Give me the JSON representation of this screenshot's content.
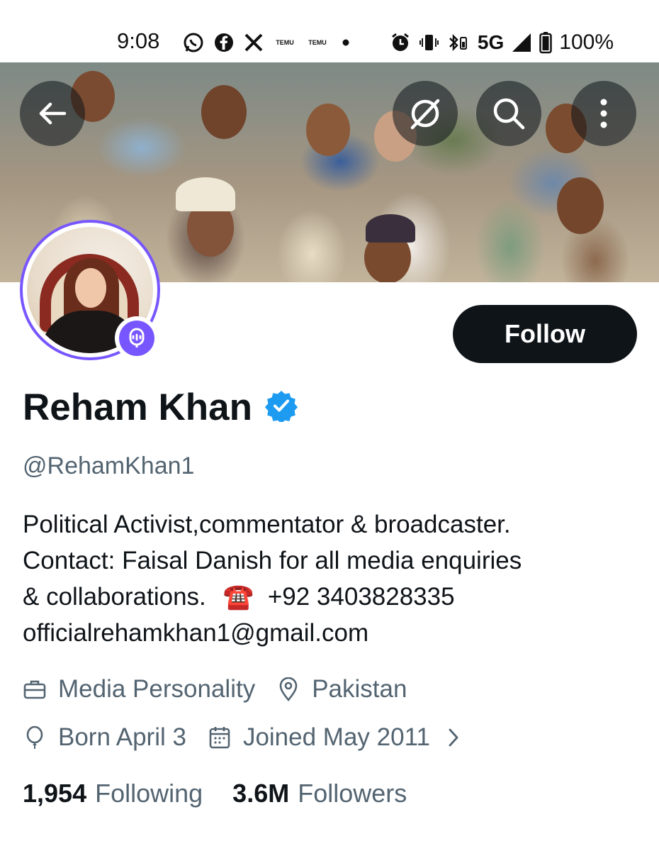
{
  "status_bar": {
    "time": "9:08",
    "network": "5G",
    "battery": "100%",
    "app_icons": [
      "whatsapp-icon",
      "facebook-icon",
      "x-icon",
      "temu-icon",
      "temu-icon",
      "dot-icon"
    ],
    "temu_label": "TEMU"
  },
  "profile": {
    "name": "Reham Khan",
    "handle": "@RehamKhan1",
    "verified": true,
    "bio": {
      "line1": "Political Activist,commentator & broadcaster.",
      "line2": "Contact: Faisal Danish for all media enquiries",
      "line3_text": "& collaborations.",
      "phone_emoji": "☎️",
      "phone": "+92 3403828335",
      "line4": "officialrehamkhan1@gmail.com"
    },
    "category": "Media Personality",
    "location": "Pakistan",
    "birthday": "Born April 3",
    "joined": "Joined May 2011",
    "following_count": "1,954",
    "following_label": "Following",
    "followers_count": "3.6M",
    "followers_label": "Followers"
  },
  "actions": {
    "follow_label": "Follow"
  },
  "colors": {
    "accent_purple": "#7856ff",
    "verified_blue": "#1d9bf0",
    "text_primary": "#0f1419",
    "text_secondary": "#536471"
  }
}
